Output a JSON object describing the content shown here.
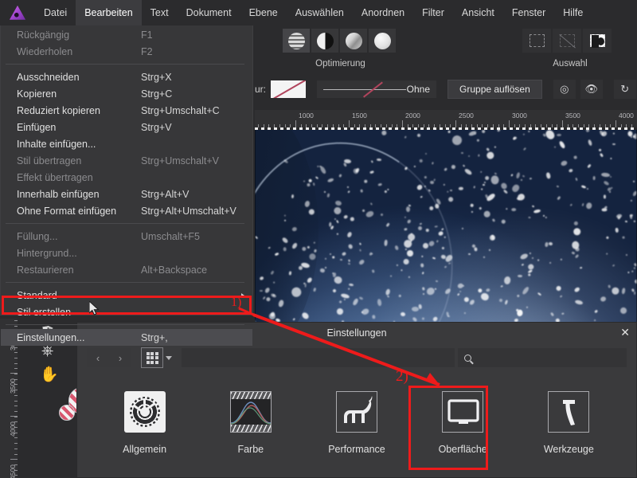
{
  "app": {
    "logo": "affinity-photo-logo",
    "menubar": [
      {
        "label": "Datei",
        "active": false
      },
      {
        "label": "Bearbeiten",
        "active": true
      },
      {
        "label": "Text",
        "active": false
      },
      {
        "label": "Dokument",
        "active": false
      },
      {
        "label": "Ebene",
        "active": false
      },
      {
        "label": "Auswählen",
        "active": false
      },
      {
        "label": "Anordnen",
        "active": false
      },
      {
        "label": "Filter",
        "active": false
      },
      {
        "label": "Ansicht",
        "active": false
      },
      {
        "label": "Fenster",
        "active": false
      },
      {
        "label": "Hilfe",
        "active": false
      }
    ]
  },
  "toolbar": {
    "optimization_label": "Optimierung",
    "selection_label": "Auswahl",
    "stroke_label": "ur:",
    "stroke_value": "Ohne",
    "ungroup_label": "Gruppe auflösen",
    "optim_icons": [
      "tone-stripe-icon",
      "half-contrast-icon",
      "gloss-icon",
      "soft-icon"
    ],
    "selection_icons": [
      "marquee-rect-icon",
      "marquee-disabled-icon",
      "invert-selection-icon"
    ],
    "right_icons": [
      "align-center-icon",
      "preview-eye-icon",
      "refresh-icon"
    ]
  },
  "edit_menu": {
    "items": [
      {
        "label": "Rückgängig",
        "shortcut": "F1",
        "disabled": true,
        "submenu": false
      },
      {
        "label": "Wiederholen",
        "shortcut": "F2",
        "disabled": true,
        "submenu": false
      },
      {
        "separator": true
      },
      {
        "label": "Ausschneiden",
        "shortcut": "Strg+X",
        "disabled": false,
        "submenu": false
      },
      {
        "label": "Kopieren",
        "shortcut": "Strg+C",
        "disabled": false,
        "submenu": false
      },
      {
        "label": "Reduziert kopieren",
        "shortcut": "Strg+Umschalt+C",
        "disabled": false,
        "submenu": false
      },
      {
        "label": "Einfügen",
        "shortcut": "Strg+V",
        "disabled": false,
        "submenu": false
      },
      {
        "label": "Inhalte einfügen...",
        "shortcut": "",
        "disabled": false,
        "submenu": false
      },
      {
        "label": "Stil übertragen",
        "shortcut": "Strg+Umschalt+V",
        "disabled": true,
        "submenu": false
      },
      {
        "label": "Effekt übertragen",
        "shortcut": "",
        "disabled": true,
        "submenu": false
      },
      {
        "label": "Innerhalb einfügen",
        "shortcut": "Strg+Alt+V",
        "disabled": false,
        "submenu": false
      },
      {
        "label": "Ohne Format einfügen",
        "shortcut": "Strg+Alt+Umschalt+V",
        "disabled": false,
        "submenu": false
      },
      {
        "separator": true
      },
      {
        "label": "Füllung...",
        "shortcut": "Umschalt+F5",
        "disabled": true,
        "submenu": false
      },
      {
        "label": "Hintergrund...",
        "shortcut": "",
        "disabled": true,
        "submenu": false
      },
      {
        "label": "Restaurieren",
        "shortcut": "Alt+Backspace",
        "disabled": true,
        "submenu": false
      },
      {
        "separator": true
      },
      {
        "label": "Standard",
        "shortcut": "",
        "disabled": false,
        "submenu": true
      },
      {
        "label": "Stil erstellen",
        "shortcut": "",
        "disabled": false,
        "submenu": false
      },
      {
        "separator": true
      },
      {
        "label": "Einstellungen...",
        "shortcut": "Strg+,",
        "disabled": false,
        "submenu": false,
        "highlight": true
      }
    ]
  },
  "rulers": {
    "horizontal_ticks": [
      "1000",
      "1500",
      "2000",
      "2500",
      "3000",
      "3500",
      "4000"
    ],
    "vertical_ticks": [
      "3000",
      "3500",
      "4000",
      "4500"
    ]
  },
  "tools": {
    "icons": [
      "pen-tool-icon",
      "paint-bucket-icon",
      "hand-tool-icon",
      "color-swatch-none-icon",
      "secondary-swatch-none-icon"
    ]
  },
  "dialog": {
    "title": "Einstellungen",
    "close_icon": "close-icon",
    "back_icon": "chevron-left-icon",
    "forward_icon": "chevron-right-icon",
    "grid_icon": "grid-view-icon",
    "search_icon": "search-icon",
    "search_value": "",
    "search_placeholder": "",
    "items": [
      {
        "label": "Allgemein",
        "icon": "gear-icon",
        "selected": false
      },
      {
        "label": "Farbe",
        "icon": "color-curve-icon",
        "selected": false
      },
      {
        "label": "Performance",
        "icon": "cat-icon",
        "selected": false
      },
      {
        "label": "Oberfläche",
        "icon": "monitor-icon",
        "selected": true
      },
      {
        "label": "Werkzeuge",
        "icon": "hammer-icon",
        "selected": false
      }
    ]
  },
  "annotations": {
    "step1": "1)",
    "step2": "2)",
    "highlight_color": "#ee1b1b"
  }
}
